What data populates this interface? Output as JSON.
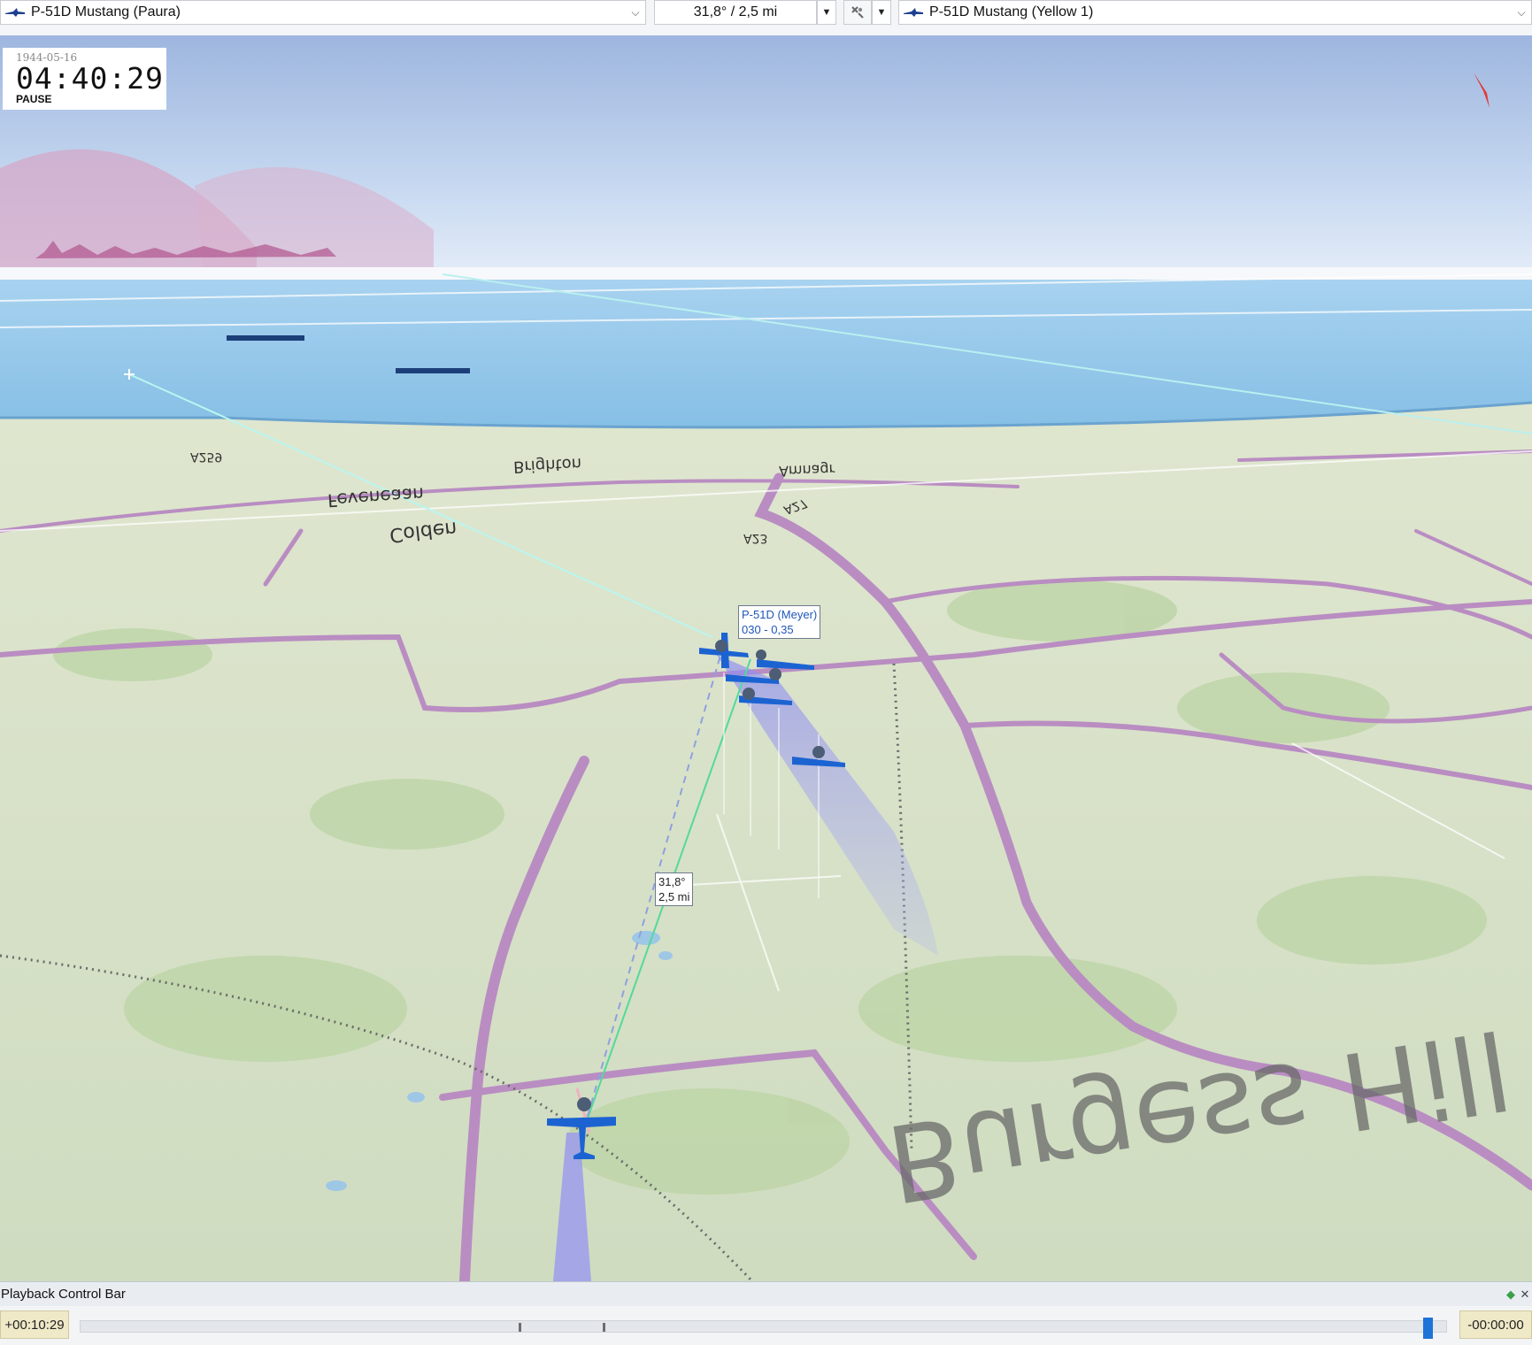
{
  "toolbar": {
    "left_aircraft": "P-51D Mustang (Paura)",
    "bearing_range": "31,8° / 2,5 mi",
    "right_aircraft": "P-51D Mustang (Yellow 1)",
    "aircraft_icon": "aircraft-icon",
    "tool_icon": "measure-tool-icon"
  },
  "clock": {
    "date": "1944-05-16",
    "time": "04:40:29",
    "state": "PAUSE"
  },
  "view": {
    "callout_name": "P-51D (Meyer)",
    "callout_info": "030 - 0,35",
    "measure_bearing": "31,8°",
    "measure_range": "2,5 mi",
    "map_labels": [
      "Burgess Hill",
      "Colden",
      "Feveneaan",
      "Brighton",
      "Amnagr",
      "A259",
      "A23",
      "A27"
    ],
    "colors": {
      "sky": "#c6d8f0",
      "sea": "#8fc3e6",
      "land": "#d9e3cf",
      "roads": "#b78bc0",
      "aircraft": "#1c63d2",
      "compass": "#e23a3a"
    }
  },
  "playback": {
    "title": "Playback Control Bar",
    "elapsed": "+00:10:29",
    "remaining": "-00:00:00",
    "position_fraction": 0.99
  }
}
